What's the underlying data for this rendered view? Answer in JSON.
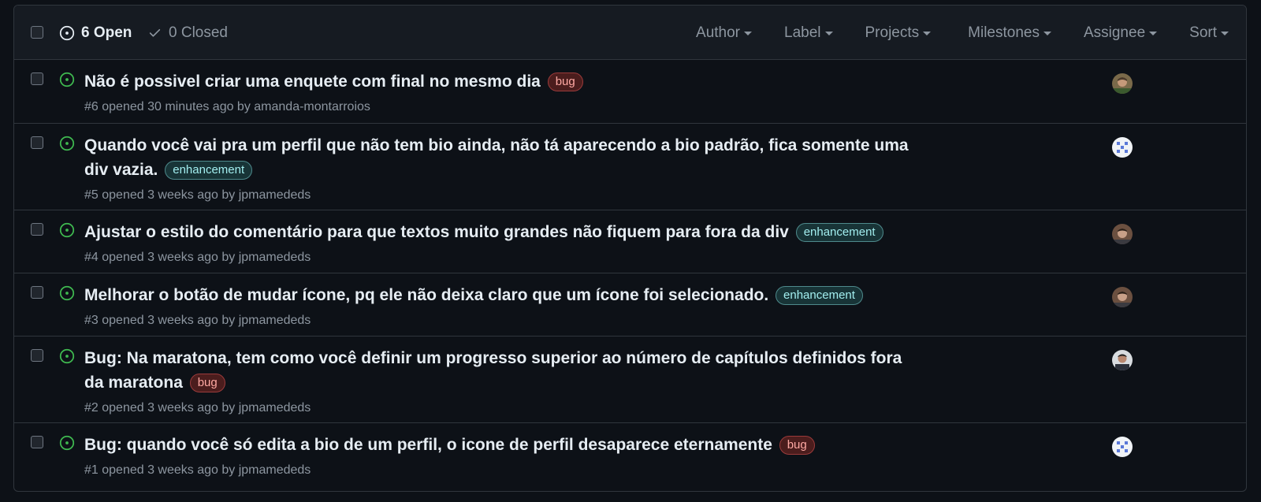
{
  "header": {
    "open_label": "6 Open",
    "closed_label": "0 Closed",
    "filters": [
      "Author",
      "Label",
      "Projects",
      "Milestones",
      "Assignee",
      "Sort"
    ]
  },
  "colors": {
    "open": "#3fb950",
    "bug_label": "#ffa9a3",
    "enhancement_label": "#a2eeef"
  },
  "issues": [
    {
      "title": "Não é possivel criar uma enquete com final no mesmo dia",
      "label": "bug",
      "meta_prefix": "#6 opened 30 minutes ago by ",
      "author": "amanda-montarroios"
    },
    {
      "title": "Quando você vai pra um perfil que não tem bio ainda, não tá aparecendo a bio padrão, fica somente uma div vazia.",
      "label": "enhancement",
      "meta_prefix": "#5 opened 3 weeks ago by ",
      "author": "jpmamededs"
    },
    {
      "title": "Ajustar o estilo do comentário para que textos muito grandes não fiquem para fora da div",
      "label": "enhancement",
      "meta_prefix": "#4 opened 3 weeks ago by ",
      "author": "jpmamededs"
    },
    {
      "title": "Melhorar o botão de mudar ícone, pq ele não deixa claro que um ícone foi selecionado.",
      "label": "enhancement",
      "meta_prefix": "#3 opened 3 weeks ago by ",
      "author": "jpmamededs"
    },
    {
      "title": "Bug: Na maratona, tem como você definir um progresso superior ao número de capítulos definidos fora da maratona",
      "label": "bug",
      "meta_prefix": "#2 opened 3 weeks ago by ",
      "author": "jpmamededs"
    },
    {
      "title": "Bug: quando você só edita a bio de um perfil, o icone de perfil desaparece eternamente",
      "label": "bug",
      "meta_prefix": "#1 opened 3 weeks ago by ",
      "author": "jpmamededs"
    }
  ]
}
